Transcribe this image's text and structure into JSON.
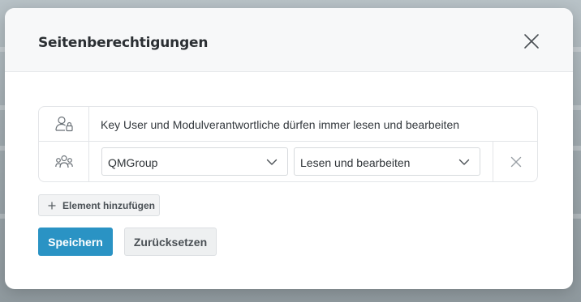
{
  "dialog": {
    "title": "Seitenberechtigungen",
    "close_icon": "close-icon"
  },
  "permissions": {
    "info_row": {
      "icon": "user-lock-icon",
      "text": "Key User und Modulverantwortliche dürfen immer lesen und bearbeiten"
    },
    "entries": [
      {
        "icon": "group-icon",
        "group": "QMGroup",
        "permission": "Lesen und bearbeiten",
        "remove_icon": "remove-icon"
      }
    ]
  },
  "actions": {
    "add_label": "Element hinzufügen",
    "save_label": "Speichern",
    "reset_label": "Zurücksetzen"
  },
  "colors": {
    "primary": "#2a93c4",
    "header_bg": "#f7f8f9",
    "border": "#e3e5e8"
  }
}
